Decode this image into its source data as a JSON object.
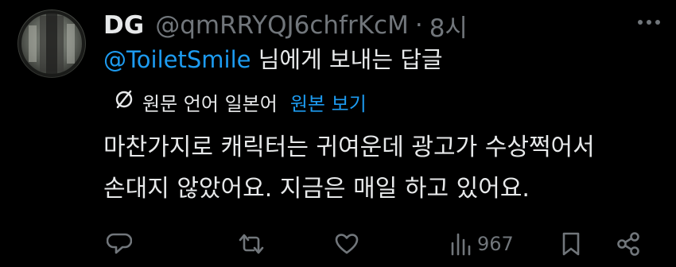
{
  "post": {
    "display_name": "DG",
    "handle": "@qmRRYQJ6chfrKcM",
    "separator": "·",
    "time": "8시",
    "reply_to": {
      "mention": "@ToiletSmile",
      "suffix": " 님에게 보내는 답글"
    },
    "translation": {
      "label": "원문 언어 일본어",
      "show_original": "원본 보기"
    },
    "text_lines": [
      "마찬가지로 캐릭터는 귀여운데 광고가 수상쩍어서",
      "손대지 않았어요. 지금은 매일 하고 있어요."
    ]
  },
  "actions": {
    "views_count": "967"
  },
  "icons": {
    "more": "more-icon",
    "translate": "translate-icon",
    "reply": "reply-icon",
    "repost": "repost-icon",
    "like": "heart-icon",
    "views": "views-icon",
    "bookmark": "bookmark-icon",
    "share": "share-icon"
  },
  "colors": {
    "background": "#000000",
    "text": "#e7e9ea",
    "secondary": "#71767b",
    "accent": "#1d9bf0"
  }
}
